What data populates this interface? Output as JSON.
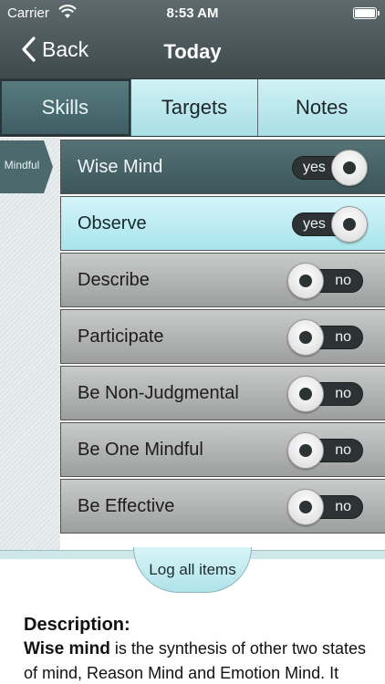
{
  "status": {
    "carrier": "Carrier",
    "time": "8:53 AM"
  },
  "nav": {
    "back_label": "Back",
    "title": "Today"
  },
  "tabs": [
    {
      "label": "Skills",
      "active": true
    },
    {
      "label": "Targets",
      "active": false
    },
    {
      "label": "Notes",
      "active": false
    }
  ],
  "category_tag": "Mindful",
  "rows": [
    {
      "label": "Wise Mind",
      "toggle": "yes",
      "state": "selected"
    },
    {
      "label": "Observe",
      "toggle": "yes",
      "state": "highlight"
    },
    {
      "label": "Describe",
      "toggle": "no",
      "state": "normal"
    },
    {
      "label": "Participate",
      "toggle": "no",
      "state": "normal"
    },
    {
      "label": "Be Non-Judgmental",
      "toggle": "no",
      "state": "normal"
    },
    {
      "label": "Be One Mindful",
      "toggle": "no",
      "state": "normal"
    },
    {
      "label": "Be Effective",
      "toggle": "no",
      "state": "normal"
    }
  ],
  "log_all_label": "Log all items",
  "description": {
    "heading": "Description:",
    "term": "Wise mind",
    "text": " is the synthesis of other two states of mind, Reason Mind and Emotion Mind. It"
  },
  "colors": {
    "selected_row": "#4a666a",
    "highlight_row": "#bfeef4",
    "normal_row": "#b4b5b5",
    "nav_bar": "#4b5659"
  },
  "icons": [
    "wifi-icon",
    "battery-icon",
    "back-chevron-icon",
    "toggle-knob-icon"
  ]
}
